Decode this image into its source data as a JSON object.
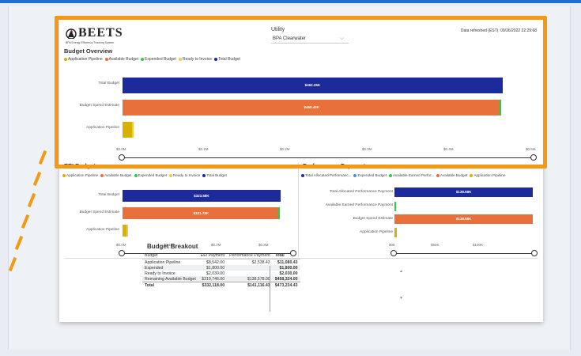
{
  "report": {
    "logo": {
      "name": "BEETS",
      "subtitle": "BPA Energy Efficiency Tracking System"
    },
    "utility": {
      "label": "Utility",
      "value": "BPA Clearwater"
    },
    "refresh": "Data refreshed (EST): 09/26/2022 22:29:68"
  },
  "colors": {
    "accent": "#f39a12",
    "application_pipeline": "#d9b100",
    "available_budget": "#e8703a",
    "expended_budget": "#2ecc40",
    "ready_to_invoice": "#f2c84b",
    "total_budget": "#1c2a9c",
    "allocated_performance": "#1c2a9c",
    "expended_budget_perf": "#4b8fe0",
    "available_earned": "#2ecc40"
  },
  "overview": {
    "title": "Budget Overview",
    "legend": [
      "Application Pipeline",
      "Available Budget",
      "Expended Budget",
      "Ready to Invoice",
      "Total Budget"
    ],
    "categories": [
      "Total Budget",
      "Budget Spend Estimate",
      "Application Pipeline"
    ],
    "bar_labels": [
      "$462.25K",
      "$460.45K",
      ""
    ],
    "ticks": [
      "$0.0M",
      "$0.1M",
      "$0.2M",
      "$0.3M",
      "$0.4M",
      "$0.5M"
    ]
  },
  "ee": {
    "title": "EEI Budget",
    "legend": [
      "Application Pipeline",
      "Available Budget",
      "Expended Budget",
      "Ready to Invoice",
      "Total Budget"
    ],
    "categories": [
      "Total Budget",
      "Budget Spend Estimate",
      "Application Pipeline"
    ],
    "bar_labels": [
      "$323.58K",
      "$321.78K",
      ""
    ],
    "ticks": [
      "$0.0M",
      "$0.1M",
      "$0.2M",
      "$0.3M"
    ]
  },
  "perf": {
    "title": "Performance Payment",
    "legend": [
      "Total Allocated Performanc...",
      "Expended Budget",
      "Available Earned Perfor...",
      "Available Budget",
      "Application Pipeline"
    ],
    "categories": [
      "Total Allocated Performance Payment",
      "Available Earned Performance Payment",
      "Budget Spend Estimate",
      "Application Pipeline"
    ],
    "bar_labels": [
      "$138.68K",
      "",
      "$138.58K",
      ""
    ],
    "ticks": [
      "$0K",
      "$50K",
      "$100K"
    ]
  },
  "breakout": {
    "title": "Budget Breakout",
    "headers": [
      "Budget",
      "EEI Payment",
      "Performance Payment",
      "Total"
    ],
    "rows": [
      [
        "Application Pipeline",
        "$8,542.00",
        "$2,538.43",
        "$11,080.43"
      ],
      [
        "Expended",
        "$1,800.00",
        "",
        "$1,800.00"
      ],
      [
        "Ready to Invoice",
        "$2,030.00",
        "",
        "$2,030.00"
      ],
      [
        "Remaining Available Budget",
        "$319,746.00",
        "$138,578.00",
        "$458,324.00"
      ]
    ],
    "total": [
      "Total",
      "$332,118.00",
      "$141,116.43",
      "$473,234.43"
    ]
  },
  "chart_data": [
    {
      "type": "bar",
      "title": "Budget Overview",
      "categories": [
        "Total Budget",
        "Budget Spend Estimate",
        "Application Pipeline"
      ],
      "series": [
        {
          "name": "Total Budget",
          "values": [
            462.25,
            0,
            0
          ]
        },
        {
          "name": "Available Budget",
          "values": [
            0,
            458.32,
            0
          ]
        },
        {
          "name": "Expended Budget",
          "values": [
            0,
            1.8,
            0
          ]
        },
        {
          "name": "Application Pipeline",
          "values": [
            0,
            0,
            11.08
          ]
        },
        {
          "name": "Ready to Invoice",
          "values": [
            0,
            0,
            2.03
          ]
        }
      ],
      "xlim": [
        0,
        500
      ]
    },
    {
      "type": "bar",
      "title": "EEI Budget",
      "categories": [
        "Total Budget",
        "Budget Spend Estimate",
        "Application Pipeline"
      ],
      "series": [
        {
          "name": "Total Budget",
          "values": [
            323.58,
            0,
            0
          ]
        },
        {
          "name": "Available Budget",
          "values": [
            0,
            319.75,
            0
          ]
        },
        {
          "name": "Expended Budget",
          "values": [
            0,
            1.8,
            0
          ]
        },
        {
          "name": "Application Pipeline",
          "values": [
            0,
            0,
            8.54
          ]
        },
        {
          "name": "Ready to Invoice",
          "values": [
            0,
            0,
            2.03
          ]
        }
      ],
      "xlim": [
        0,
        350
      ]
    },
    {
      "type": "bar",
      "title": "Performance Payment",
      "categories": [
        "Total Allocated Performance Payment",
        "Available Earned Performance Payment",
        "Budget Spend Estimate",
        "Application Pipeline"
      ],
      "series": [
        {
          "name": "Total Allocated Performanc...",
          "values": [
            138.68,
            0,
            0,
            0
          ]
        },
        {
          "name": "Available Earned Perfor...",
          "values": [
            0,
            0.3,
            0,
            0
          ]
        },
        {
          "name": "Available Budget",
          "values": [
            0,
            0,
            138.58,
            0
          ]
        },
        {
          "name": "Application Pipeline",
          "values": [
            0,
            0,
            0,
            2.54
          ]
        }
      ],
      "xlim": [
        0,
        140
      ]
    }
  ]
}
